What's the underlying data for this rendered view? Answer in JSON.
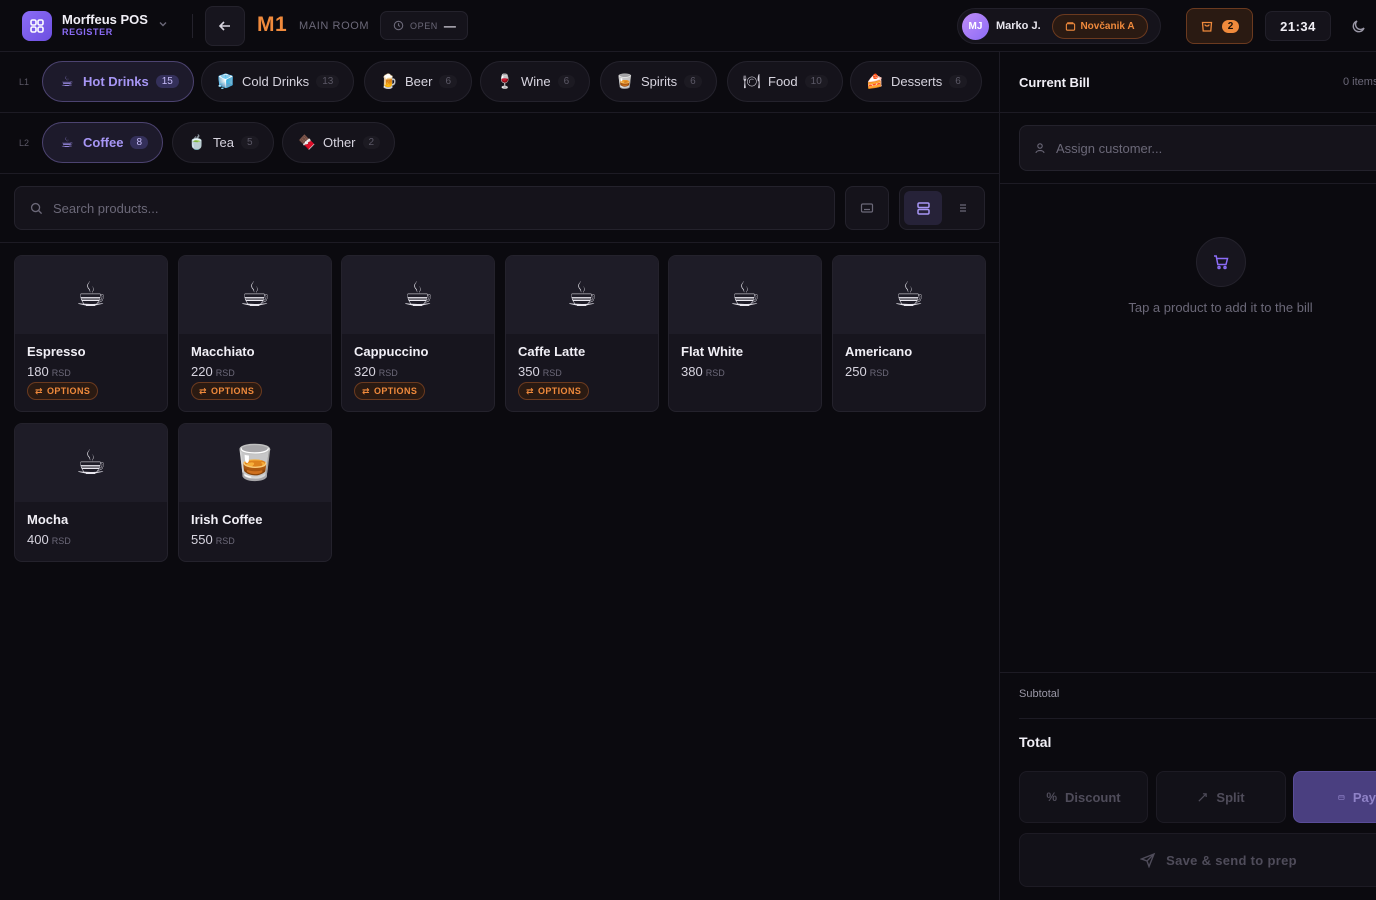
{
  "header": {
    "app_name": "Morffeus POS",
    "app_sub": "REGISTER",
    "table_code": "M1",
    "room_name": "MAIN ROOM",
    "status_label": "OPEN",
    "status_value": "—",
    "user_initials": "MJ",
    "user_name": "Marko J.",
    "shift_label": "Novčanik A",
    "orders_count": "2",
    "clock": "21:34"
  },
  "categories": {
    "l1_label": "L1",
    "l2_label": "L2",
    "l1": [
      {
        "label": "Hot Drinks",
        "count": "15",
        "emoji": "☕"
      },
      {
        "label": "Cold Drinks",
        "count": "13",
        "emoji": "🧊"
      },
      {
        "label": "Beer",
        "count": "6",
        "emoji": "🍺"
      },
      {
        "label": "Wine",
        "count": "6",
        "emoji": "🍷"
      },
      {
        "label": "Spirits",
        "count": "6",
        "emoji": "🥃"
      },
      {
        "label": "Food",
        "count": "10",
        "emoji": "🍽"
      },
      {
        "label": "Desserts",
        "count": "6",
        "emoji": "🍰"
      }
    ],
    "l2": [
      {
        "label": "Coffee",
        "count": "8",
        "emoji": "☕"
      },
      {
        "label": "Tea",
        "count": "5",
        "emoji": "🍵"
      },
      {
        "label": "Other",
        "count": "2",
        "emoji": "🍫"
      }
    ]
  },
  "search": {
    "placeholder": "Search products..."
  },
  "products": [
    {
      "name": "Espresso",
      "price": "180",
      "currency": "RSD",
      "options": "OPTIONS",
      "emoji": "☕"
    },
    {
      "name": "Macchiato",
      "price": "220",
      "currency": "RSD",
      "options": "OPTIONS",
      "emoji": "☕"
    },
    {
      "name": "Cappuccino",
      "price": "320",
      "currency": "RSD",
      "options": "OPTIONS",
      "emoji": "☕"
    },
    {
      "name": "Caffe Latte",
      "price": "350",
      "currency": "RSD",
      "options": "OPTIONS",
      "emoji": "☕"
    },
    {
      "name": "Flat White",
      "price": "380",
      "currency": "RSD",
      "emoji": "☕"
    },
    {
      "name": "Americano",
      "price": "250",
      "currency": "RSD",
      "emoji": "☕"
    },
    {
      "name": "Mocha",
      "price": "400",
      "currency": "RSD",
      "emoji": "☕"
    },
    {
      "name": "Irish Coffee",
      "price": "550",
      "currency": "RSD",
      "emoji": "🥃"
    }
  ],
  "bill": {
    "title": "Current Bill",
    "items_count": "0 items",
    "customer_placeholder": "Assign customer...",
    "empty_text": "Tap a product to add it to the bill",
    "subtotal_label": "Subtotal",
    "total_label": "Total",
    "discount_label": "Discount",
    "split_label": "Split",
    "pay_label": "Pay",
    "send_label": "Save & send to prep"
  }
}
